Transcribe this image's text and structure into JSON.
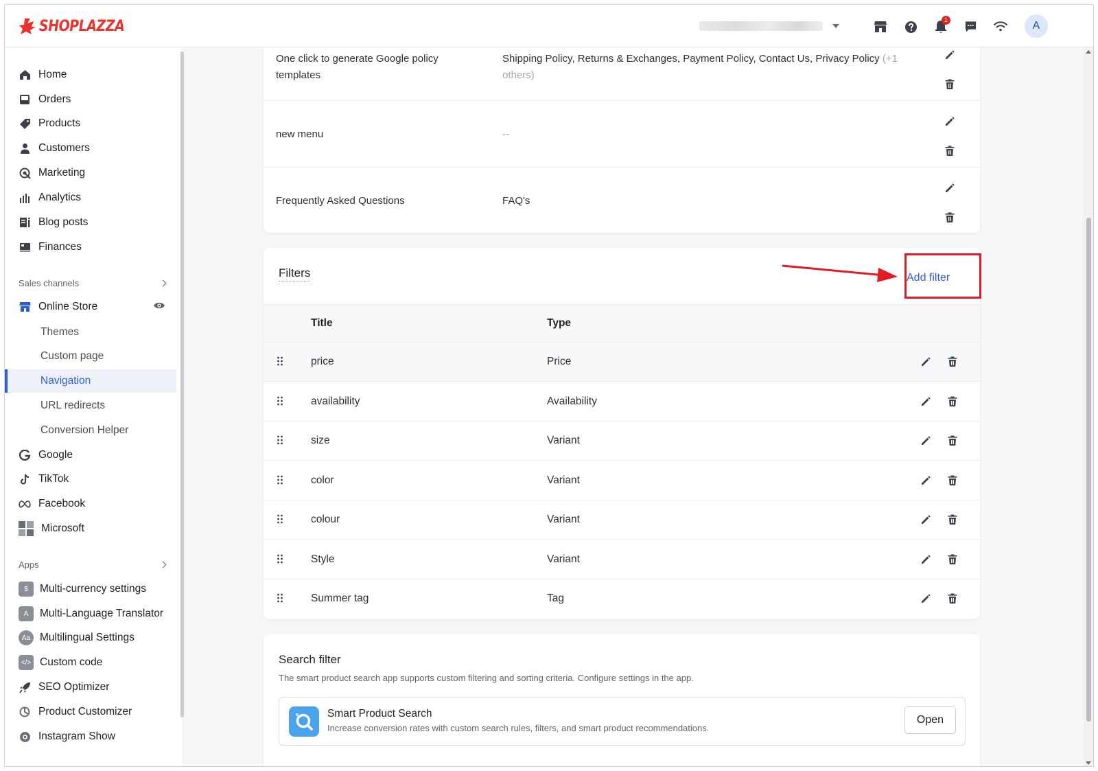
{
  "brand": {
    "name": "SHOPLAZZA",
    "color": "#e8322b",
    "accent": "#2e5ed6"
  },
  "topbar": {
    "notification_count": "1",
    "avatar_letter": "A",
    "icons": [
      "store-icon",
      "help-icon",
      "bell-icon",
      "chat-icon",
      "wifi-icon"
    ]
  },
  "sidebar": {
    "main": [
      {
        "label": "Home",
        "icon": "home-icon"
      },
      {
        "label": "Orders",
        "icon": "inbox-icon"
      },
      {
        "label": "Products",
        "icon": "tag-icon"
      },
      {
        "label": "Customers",
        "icon": "person-icon"
      },
      {
        "label": "Marketing",
        "icon": "target-icon"
      },
      {
        "label": "Analytics",
        "icon": "bar-chart-icon"
      },
      {
        "label": "Blog posts",
        "icon": "blog-icon"
      },
      {
        "label": "Finances",
        "icon": "finance-icon"
      }
    ],
    "sales_channels_label": "Sales channels",
    "online_store_label": "Online Store",
    "online_store_sub": [
      {
        "label": "Themes"
      },
      {
        "label": "Custom page"
      },
      {
        "label": "Navigation",
        "active": true
      },
      {
        "label": "URL redirects"
      },
      {
        "label": "Conversion Helper"
      }
    ],
    "channels": [
      {
        "label": "Google",
        "icon": "google-icon"
      },
      {
        "label": "TikTok",
        "icon": "tiktok-icon"
      },
      {
        "label": "Facebook",
        "icon": "meta-icon"
      },
      {
        "label": "Microsoft",
        "icon": "microsoft-icon"
      }
    ],
    "apps_label": "Apps",
    "apps": [
      {
        "label": "Multi-currency settings",
        "icon": "currency-app-icon"
      },
      {
        "label": "Multi-Language Translator",
        "icon": "translator-app-icon"
      },
      {
        "label": "Multilingual Settings",
        "icon": "multilingual-app-icon"
      },
      {
        "label": "Custom code",
        "icon": "code-app-icon"
      },
      {
        "label": "SEO Optimizer",
        "icon": "rocket-icon"
      },
      {
        "label": "Product Customizer",
        "icon": "customizer-icon"
      },
      {
        "label": "Instagram Show",
        "icon": "instagram-icon"
      }
    ]
  },
  "menus": [
    {
      "title": "One click to generate Google policy templates",
      "items": "Shipping Policy, Returns & Exchanges, Payment Policy, Contact Us, Privacy Policy",
      "more": "(+1 others)"
    },
    {
      "title": "new menu",
      "items": "--",
      "more": ""
    },
    {
      "title": "Frequently Asked Questions",
      "items": "FAQ's",
      "more": ""
    }
  ],
  "filters": {
    "heading": "Filters",
    "add_label": "Add filter",
    "columns": {
      "title": "Title",
      "type": "Type"
    },
    "rows": [
      {
        "title": "price",
        "type": "Price"
      },
      {
        "title": "availability",
        "type": "Availability"
      },
      {
        "title": "size",
        "type": "Variant"
      },
      {
        "title": "color",
        "type": "Variant"
      },
      {
        "title": "colour",
        "type": "Variant"
      },
      {
        "title": "Style",
        "type": "Variant"
      },
      {
        "title": "Summer tag",
        "type": "Tag"
      }
    ]
  },
  "search_filter": {
    "heading": "Search filter",
    "description": "The smart product search app supports custom filtering and sorting criteria. Configure settings in the app.",
    "app_name": "Smart Product Search",
    "app_description": "Increase conversion rates with custom search rules, filters, and smart product recommendations.",
    "open_label": "Open"
  }
}
